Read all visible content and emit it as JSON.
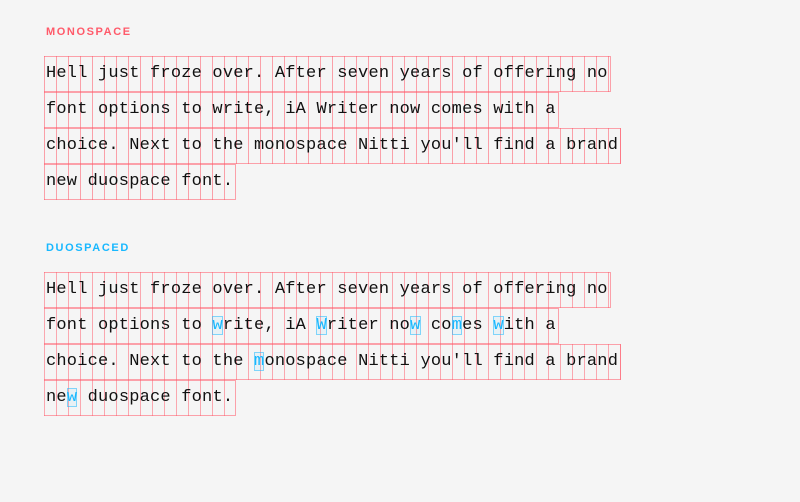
{
  "mono": {
    "label": "MONOSPACE",
    "lines": [
      "Hell just froze over. After seven years of offering no",
      "font options to write, iA Writer now comes with a",
      "choice. Next to the monospace Nitti you'll find a brand",
      "new duospace font."
    ]
  },
  "duo": {
    "label": "DUOSPACED",
    "segments": [
      [
        {
          "t": "Hell just froze over. After seven years of offering no"
        }
      ],
      [
        {
          "t": "font options to "
        },
        {
          "t": "w",
          "hl": true
        },
        {
          "t": "rite, iA "
        },
        {
          "t": "W",
          "hl": true
        },
        {
          "t": "riter no"
        },
        {
          "t": "w",
          "hl": true
        },
        {
          "t": " co"
        },
        {
          "t": "m",
          "hl": true
        },
        {
          "t": "es "
        },
        {
          "t": "w",
          "hl": true
        },
        {
          "t": "ith a"
        }
      ],
      [
        {
          "t": "choice. Next to the "
        },
        {
          "t": "m",
          "hl": true
        },
        {
          "t": "onospace Nitti you'll find a brand"
        }
      ],
      [
        {
          "t": "ne"
        },
        {
          "t": "w",
          "hl": true
        },
        {
          "t": " duospace font."
        }
      ]
    ]
  },
  "colors": {
    "mono_accent": "#ff5a6a",
    "duo_accent": "#18b8ff"
  }
}
